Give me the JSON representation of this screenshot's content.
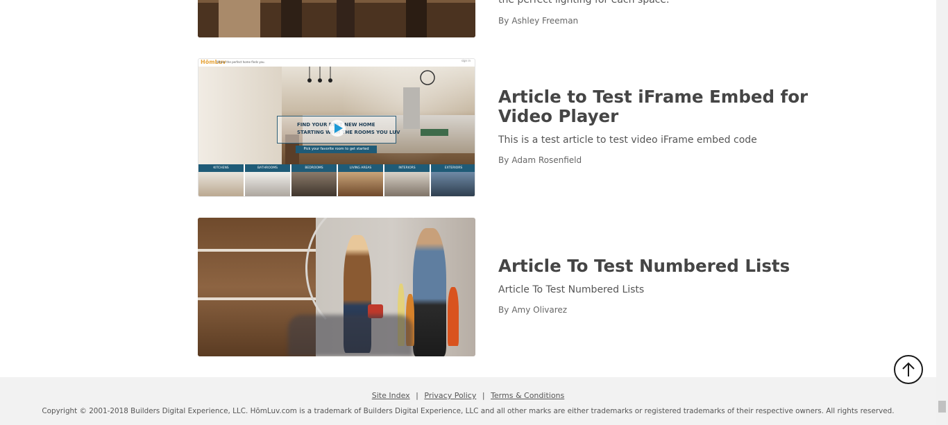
{
  "articles": [
    {
      "title": "",
      "description_partial": "the perfect lighting for each space.",
      "author_prefix": "By",
      "author": "Ashley Freeman"
    },
    {
      "title": "Article to Test iFrame Embed for Video Player",
      "description": "This is a test article to test video iFrame embed code",
      "author_prefix": "By",
      "author": "Adam Rosenfield",
      "thumbnail": {
        "brand": "HōmLuv",
        "tagline": "Where the perfect home finds you.",
        "signin": "sign in",
        "overlay_line1": "FIND YOUR BEST NEW HOME",
        "overlay_line2": "STARTING WITH THE ROOMS YOU LUV",
        "cta": "Pick your favorite room to get started",
        "categories": [
          "KITCHENS",
          "BATHROOMS",
          "BEDROOMS",
          "LIVING AREAS",
          "INTERIORS",
          "EXTERIORS"
        ]
      }
    },
    {
      "title": "Article To Test Numbered Lists",
      "description": "Article To Test Numbered Lists",
      "author_prefix": "By",
      "author": "Amy Olivarez"
    }
  ],
  "footer": {
    "links": [
      "Site Index",
      "Privacy Policy",
      "Terms & Conditions"
    ],
    "separator": "|",
    "copyright": "Copyright © 2001-2018 Builders Digital Experience, LLC. HōmLuv.com is a trademark of Builders Digital Experience, LLC and all other marks are either trademarks or registered trademarks of their respective owners. All rights reserved."
  },
  "colors": {
    "footer_bg": "#f2f2f2",
    "brand_teal": "#1f5b77",
    "play_blue": "#1e9ad6"
  },
  "icons": {
    "back_to_top": "arrow-up-circle-icon",
    "play": "play-icon"
  }
}
